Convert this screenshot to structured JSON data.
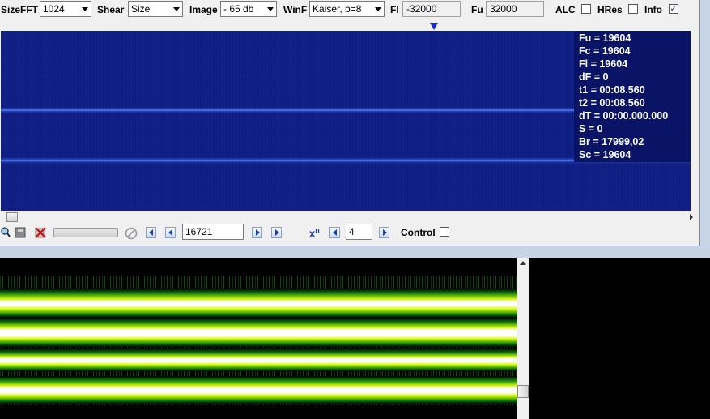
{
  "toolbar": {
    "sizefft_label": "SizeFFT",
    "sizefft_value": "1024",
    "shear_label": "Shear",
    "shear_value": "Size",
    "image_label": "Image",
    "image_value": "- 65 db",
    "winf_label": "WinF",
    "winf_value": "Kaiser, b=8",
    "fl_label": "Fl",
    "fl_value": "-32000",
    "fu_label": "Fu",
    "fu_value": "32000",
    "alc_label": "ALC",
    "hres_label": "HRes",
    "hres_checked": false,
    "info_label": "Info",
    "info_checked": true
  },
  "info": {
    "fu": "Fu = 19604",
    "fc": "Fc = 19604",
    "fl": "Fl = 19604",
    "df": "dF = 0",
    "t1": "t1 = 00:08.560",
    "t2": "t2 = 00:08.560",
    "dt": "dT = 00:00.000.000",
    "s": "S = 0",
    "br": "Br = 17999,02",
    "sc": "Sc = 19604"
  },
  "controls": {
    "position_value": "16721",
    "zoom_symbol": "x",
    "zoom_superscript": "n",
    "zoom_value": "4",
    "control_label": "Control",
    "control_checked": false
  },
  "icons": {
    "zoom": "magnifier-icon",
    "save": "floppy-icon",
    "delete": "red-x-icon",
    "cancel": "no-entry-icon"
  },
  "colors": {
    "spectrogram_bg": "#0d1a7a",
    "spectral_line": "#3a6cf0",
    "band_core": "#ffffff",
    "band_edge": "#d8ff00",
    "band_glow": "#1cc81c"
  }
}
